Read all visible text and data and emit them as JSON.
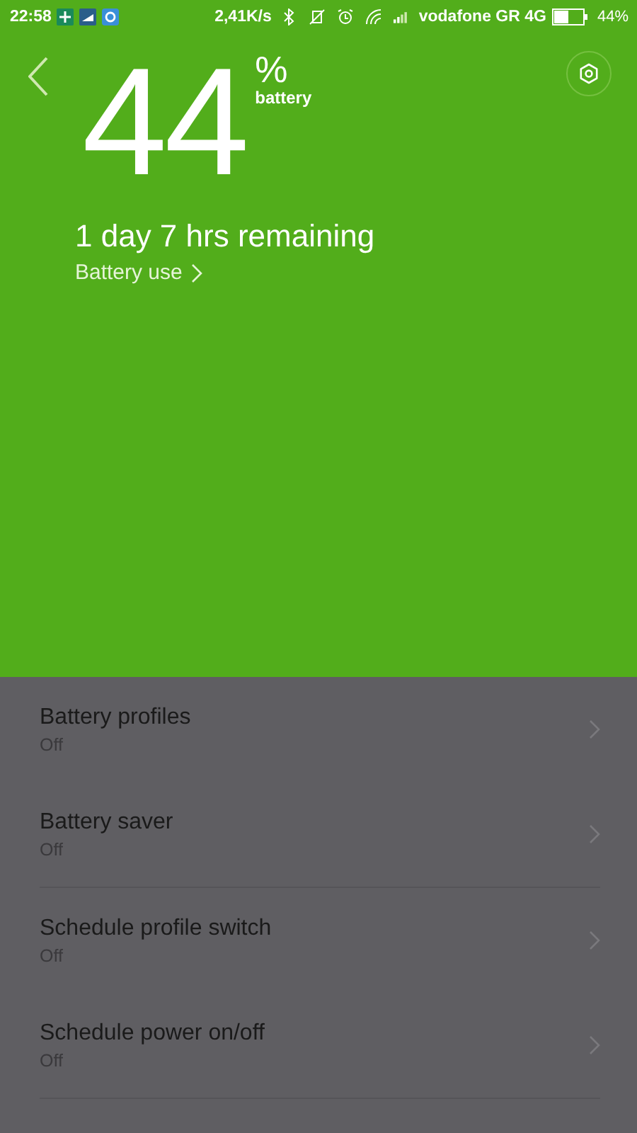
{
  "status_bar": {
    "time": "22:58",
    "speed": "2,41K/s",
    "carrier": "vodafone GR 4G",
    "battery": "44%"
  },
  "header": {
    "percent": "44",
    "percent_sign": "%",
    "unit": "battery",
    "remaining": "1 day 7 hrs remaining",
    "link": "Battery use"
  },
  "sections": [
    {
      "items": [
        {
          "title": "Battery profiles",
          "value": "Off"
        },
        {
          "title": "Battery saver",
          "value": "Off"
        }
      ]
    },
    {
      "items": [
        {
          "title": "Schedule profile switch",
          "value": "Off"
        },
        {
          "title": "Schedule power on/off",
          "value": "Off"
        }
      ]
    }
  ]
}
